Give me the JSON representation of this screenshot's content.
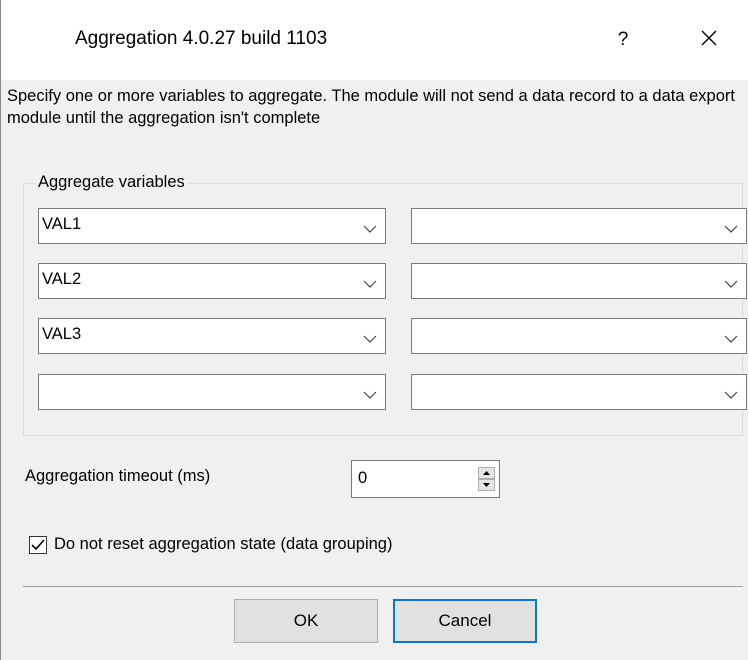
{
  "window": {
    "title": "Aggregation 4.0.27 build 1103",
    "help_label": "?",
    "close_icon": "close-icon"
  },
  "description": "Specify one or more variables to aggregate. The module will not send a data record to a data export module until the aggregation isn't complete",
  "aggregate_group": {
    "legend": "Aggregate variables",
    "rows": [
      {
        "left": "VAL1",
        "right": ""
      },
      {
        "left": "VAL2",
        "right": ""
      },
      {
        "left": "VAL3",
        "right": ""
      },
      {
        "left": "",
        "right": ""
      }
    ]
  },
  "timeout": {
    "label": "Aggregation timeout (ms)",
    "value": "0"
  },
  "no_reset": {
    "checked": true,
    "label": "Do not reset aggregation state (data grouping)"
  },
  "buttons": {
    "ok": "OK",
    "cancel": "Cancel"
  },
  "colors": {
    "accent": "#0078d7",
    "dialog_bg": "#f0f0f0"
  }
}
